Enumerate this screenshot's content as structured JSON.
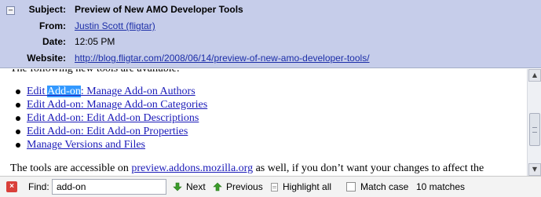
{
  "header": {
    "collapse_symbol": "−",
    "rows": [
      {
        "label": "Subject:",
        "value": "Preview of New AMO Developer Tools"
      },
      {
        "label": "From:",
        "value": "Justin Scott (fligtar)"
      },
      {
        "label": "Date:",
        "value": "12:05 PM"
      },
      {
        "label": "Website:",
        "value": "http://blog.fligtar.com/2008/06/14/preview-of-new-amo-developer-tools/"
      }
    ]
  },
  "body": {
    "intro": "The following new tools are available:",
    "items": [
      {
        "prefix": "Edit ",
        "match": "Add-on",
        "rest": ": Manage Add-on Authors"
      },
      {
        "prefix": "",
        "match": "",
        "rest": "Edit Add-on: Manage Add-on Categories"
      },
      {
        "prefix": "",
        "match": "",
        "rest": "Edit Add-on: Edit Add-on Descriptions"
      },
      {
        "prefix": "",
        "match": "",
        "rest": "Edit Add-on: Edit Add-on Properties"
      },
      {
        "prefix": "",
        "match": "",
        "rest": "Manage Versions and Files"
      }
    ],
    "tail_before": "The tools are accessible on ",
    "tail_link": "preview.addons.mozilla.org",
    "tail_after": " as well, if you don’t want your changes to affect the"
  },
  "scrollbar": {
    "up_icon": "scroll-up-arrow",
    "down_icon": "scroll-down-arrow"
  },
  "findbar": {
    "close_icon": "close-icon",
    "close_symbol": "×",
    "label": "Find:",
    "query": "add-on",
    "next_label": "Next",
    "previous_label": "Previous",
    "highlight_label": "Highlight all",
    "match_case_label": "Match case",
    "match_case_checked": false,
    "status": "10 matches"
  },
  "colors": {
    "header_bg": "#c6cdea",
    "link": "#1a1ab8",
    "highlight": "#3399ff",
    "arrow_green": "#3a9a2a",
    "close_red": "#d9403a"
  }
}
